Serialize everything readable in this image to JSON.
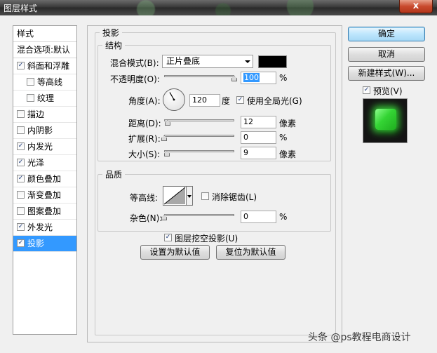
{
  "window": {
    "title": "图层样式",
    "close_glyph": "x"
  },
  "styles_list": {
    "header": "样式",
    "blend_options": "混合选项:默认",
    "items": [
      {
        "label": "斜面和浮雕",
        "checked": true,
        "sub": false,
        "selected": false
      },
      {
        "label": "等高线",
        "checked": false,
        "sub": true,
        "selected": false
      },
      {
        "label": "纹理",
        "checked": false,
        "sub": true,
        "selected": false
      },
      {
        "label": "描边",
        "checked": false,
        "sub": false,
        "selected": false
      },
      {
        "label": "内阴影",
        "checked": false,
        "sub": false,
        "selected": false
      },
      {
        "label": "内发光",
        "checked": true,
        "sub": false,
        "selected": false
      },
      {
        "label": "光泽",
        "checked": true,
        "sub": false,
        "selected": false
      },
      {
        "label": "颜色叠加",
        "checked": true,
        "sub": false,
        "selected": false
      },
      {
        "label": "渐变叠加",
        "checked": false,
        "sub": false,
        "selected": false
      },
      {
        "label": "图案叠加",
        "checked": false,
        "sub": false,
        "selected": false
      },
      {
        "label": "外发光",
        "checked": true,
        "sub": false,
        "selected": false
      },
      {
        "label": "投影",
        "checked": true,
        "sub": false,
        "selected": true
      }
    ]
  },
  "drop_shadow": {
    "title": "投影",
    "structure": {
      "title": "结构",
      "blend_mode_label": "混合模式(B):",
      "blend_mode_value": "正片叠底",
      "shadow_color": "#000000",
      "opacity_label": "不透明度(O):",
      "opacity_value": "100",
      "opacity_unit": "%",
      "opacity_fraction": 1.0,
      "angle_label": "角度(A):",
      "angle_value": "120",
      "angle_unit": "度",
      "angle_degrees": 120,
      "global_light_label": "使用全局光(G)",
      "global_light_checked": true,
      "distance_label": "距离(D):",
      "distance_value": "12",
      "distance_unit": "像素",
      "distance_fraction": 0.05,
      "spread_label": "扩展(R):",
      "spread_value": "0",
      "spread_unit": "%",
      "spread_fraction": 0.0,
      "size_label": "大小(S):",
      "size_value": "9",
      "size_unit": "像素",
      "size_fraction": 0.04
    },
    "quality": {
      "title": "品质",
      "contour_label": "等高线:",
      "anti_alias_label": "消除锯齿(L)",
      "anti_alias_checked": false,
      "noise_label": "杂色(N):",
      "noise_value": "0",
      "noise_unit": "%",
      "noise_fraction": 0.0
    },
    "knockout_label": "图层挖空投影(U)",
    "knockout_checked": true,
    "make_default_label": "设置为默认值",
    "reset_default_label": "复位为默认值"
  },
  "actions": {
    "ok_label": "确定",
    "cancel_label": "取消",
    "new_style_label": "新建样式(W)...",
    "preview_label": "预览(V)",
    "preview_checked": true
  },
  "watermark": "头条 @ps教程电商设计"
}
